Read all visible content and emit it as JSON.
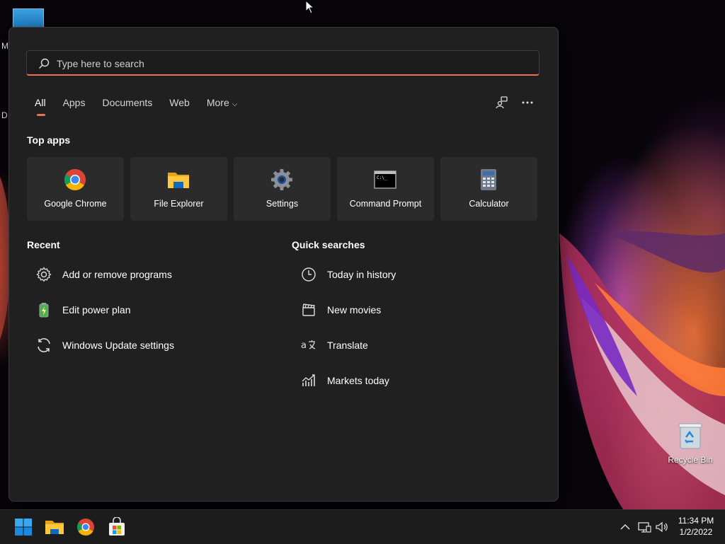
{
  "desktop": {
    "left_letters": [
      "M",
      "D"
    ],
    "recycle_bin_label": "Recycle Bin"
  },
  "search": {
    "placeholder": "Type here to search"
  },
  "tabs": [
    {
      "label": "All",
      "active": true
    },
    {
      "label": "Apps"
    },
    {
      "label": "Documents"
    },
    {
      "label": "Web"
    },
    {
      "label": "More"
    }
  ],
  "top_apps": {
    "title": "Top apps",
    "items": [
      {
        "label": "Google Chrome",
        "icon": "chrome-icon"
      },
      {
        "label": "File Explorer",
        "icon": "folder-icon"
      },
      {
        "label": "Settings",
        "icon": "gear-icon"
      },
      {
        "label": "Command Prompt",
        "icon": "terminal-icon"
      },
      {
        "label": "Calculator",
        "icon": "calculator-icon"
      }
    ]
  },
  "recent": {
    "title": "Recent",
    "items": [
      {
        "label": "Add or remove programs",
        "icon": "gear-icon"
      },
      {
        "label": "Edit power plan",
        "icon": "battery-icon"
      },
      {
        "label": "Windows Update settings",
        "icon": "sync-icon"
      }
    ]
  },
  "quick_searches": {
    "title": "Quick searches",
    "items": [
      {
        "label": "Today in history",
        "icon": "clock-icon"
      },
      {
        "label": "New movies",
        "icon": "clapperboard-icon"
      },
      {
        "label": "Translate",
        "icon": "translate-icon"
      },
      {
        "label": "Markets today",
        "icon": "chart-icon"
      }
    ]
  },
  "taskbar": {
    "time": "11:34 PM",
    "date": "1/2/2022"
  },
  "colors": {
    "accent": "#e8735a",
    "panel_bg": "#202020",
    "tile_bg": "#2b2b2b"
  }
}
